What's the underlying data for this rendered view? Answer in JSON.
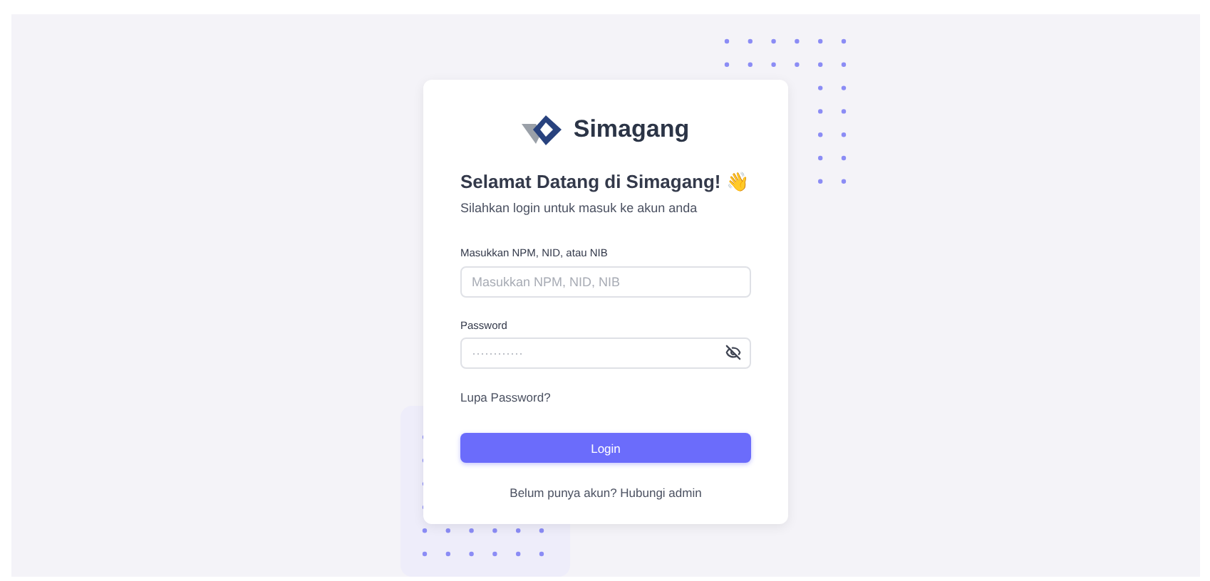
{
  "brand": "Simagang",
  "heading": "Selamat Datang di Simagang! 👋",
  "subtitle": "Silahkan login untuk masuk ke akun anda",
  "fields": [
    {
      "kind": "text",
      "label": "Masukkan NPM, NID, atau NIB",
      "placeholder": "Masukkan NPM, NID, NIB"
    },
    {
      "kind": "password",
      "label": "Password",
      "placeholder": "············"
    }
  ],
  "forgot_link": "Lupa Password?",
  "login_button": "Login",
  "footer": "Belum punya akun? Hubungi admin"
}
